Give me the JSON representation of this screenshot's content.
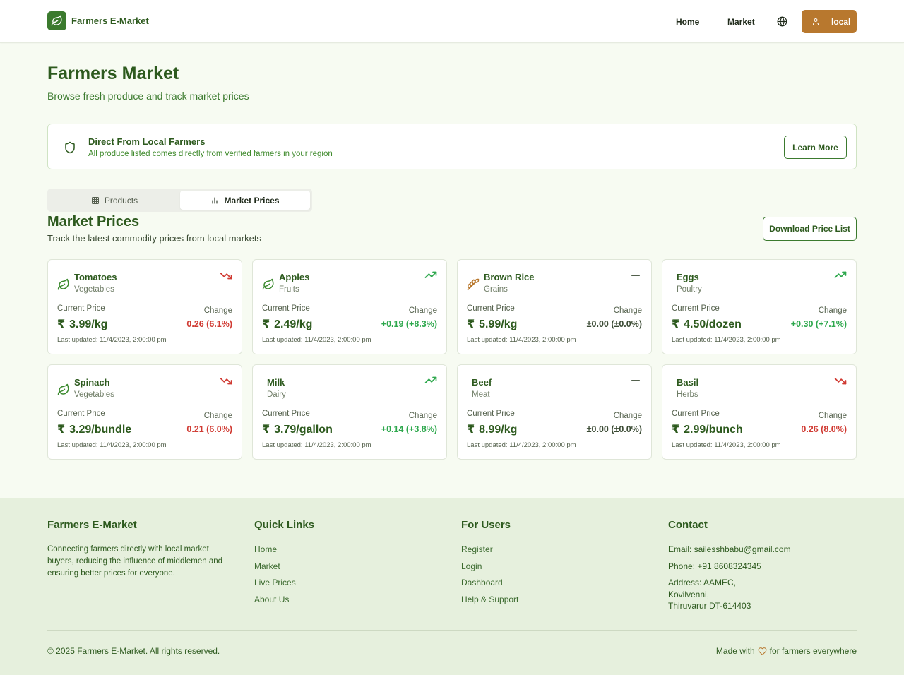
{
  "header": {
    "logo_text": "Farmers E-Market",
    "nav_home": "Home",
    "nav_market": "Market",
    "user_label": "local",
    "icons": {
      "logo": "leaf-icon",
      "language": "globe-icon",
      "user": "user-icon"
    },
    "accent": "#b8782e",
    "brand": "#3b7a2e"
  },
  "hero": {
    "title": "Farmers Market",
    "subtitle": "Browse fresh produce and track market prices"
  },
  "banner": {
    "title": "Direct From Local Farmers",
    "text": "All produce listed comes directly from verified farmers in your region",
    "button": "Learn More",
    "icon": "shield-icon"
  },
  "tabs": {
    "products": "Products",
    "market_prices": "Market Prices",
    "active": "market_prices"
  },
  "market": {
    "title": "Market Prices",
    "subtitle": "Track the latest commodity prices from local markets",
    "download_button": "Download Price List",
    "price_label": "Current Price",
    "change_label": "Change",
    "currency": "₹",
    "items": [
      {
        "name": "Tomatoes",
        "category": "Vegetables",
        "price": "3.99/kg",
        "change": "0.26 (6.1%)",
        "trend": "down",
        "icon": "leaf-icon",
        "updated": "Last updated: 11/4/2023, 2:00:00 pm"
      },
      {
        "name": "Apples",
        "category": "Fruits",
        "price": "2.49/kg",
        "change": "+0.19 (+8.3%)",
        "trend": "up",
        "icon": "leaf-icon",
        "updated": "Last updated: 11/4/2023, 2:00:00 pm"
      },
      {
        "name": "Brown Rice",
        "category": "Grains",
        "price": "5.99/kg",
        "change": "±0.00 (±0.0%)",
        "trend": "flat",
        "icon": "wheat-icon",
        "updated": "Last updated: 11/4/2023, 2:00:00 pm"
      },
      {
        "name": "Eggs",
        "category": "Poultry",
        "price": "4.50/dozen",
        "change": "+0.30 (+7.1%)",
        "trend": "up",
        "icon": "",
        "updated": "Last updated: 11/4/2023, 2:00:00 pm"
      },
      {
        "name": "Spinach",
        "category": "Vegetables",
        "price": "3.29/bundle",
        "change": "0.21 (6.0%)",
        "trend": "down",
        "icon": "leaf-icon",
        "updated": "Last updated: 11/4/2023, 2:00:00 pm"
      },
      {
        "name": "Milk",
        "category": "Dairy",
        "price": "3.79/gallon",
        "change": "+0.14 (+3.8%)",
        "trend": "up",
        "icon": "",
        "updated": "Last updated: 11/4/2023, 2:00:00 pm"
      },
      {
        "name": "Beef",
        "category": "Meat",
        "price": "8.99/kg",
        "change": "±0.00 (±0.0%)",
        "trend": "flat",
        "icon": "",
        "updated": "Last updated: 11/4/2023, 2:00:00 pm"
      },
      {
        "name": "Basil",
        "category": "Herbs",
        "price": "2.99/bunch",
        "change": "0.26 (8.0%)",
        "trend": "down",
        "icon": "",
        "updated": "Last updated: 11/4/2023, 2:00:00 pm"
      }
    ],
    "colors": {
      "down": "#d03a32",
      "up": "#2ea84d",
      "flat": "#3a4a33"
    }
  },
  "footer": {
    "about": {
      "title": "Farmers E-Market",
      "text": "Connecting farmers directly with local market buyers, reducing the influence of middlemen and ensuring better prices for everyone."
    },
    "quick_links": {
      "title": "Quick Links",
      "items": [
        "Home",
        "Market",
        "Live Prices",
        "About Us"
      ]
    },
    "for_users": {
      "title": "For Users",
      "items": [
        "Register",
        "Login",
        "Dashboard",
        "Help & Support"
      ]
    },
    "contact": {
      "title": "Contact",
      "email": "Email: sailesshbabu@gmail.com",
      "phone": "Phone: +91 8608324345",
      "address_1": "Address: AAMEC,",
      "address_2": "Kovilvenni,",
      "address_3": "Thiruvarur DT-614403"
    },
    "copyright": "© 2025 Farmers E-Market. All rights reserved.",
    "made_with_prefix": "Made with",
    "made_with_suffix": "for farmers everywhere"
  }
}
